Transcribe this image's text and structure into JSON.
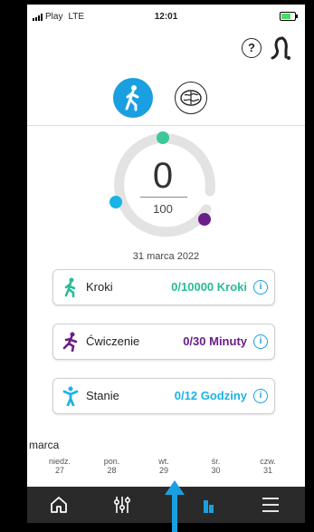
{
  "status": {
    "carrier": "Play",
    "network": "LTE",
    "time": "12:01"
  },
  "header": {
    "help_label": "?"
  },
  "ring": {
    "value": "0",
    "goal": "100",
    "colors": {
      "track": "#e3e3e3",
      "green": "#3ec79b",
      "blue": "#1ab3e6",
      "purple": "#6a1e8a"
    }
  },
  "date": "31 marca 2022",
  "cards": [
    {
      "label": "Kroki",
      "value": "0/10000 Kroki",
      "color": "#2bbb96",
      "icon": "walking-person-icon"
    },
    {
      "label": "Ćwiczenie",
      "value": "0/30 Minuty",
      "color": "#6a1e8a",
      "icon": "running-person-icon"
    },
    {
      "label": "Stanie",
      "value": "0/12 Godziny",
      "color": "#1ab3e6",
      "icon": "standing-person-icon"
    }
  ],
  "info_label": "i",
  "calendar": {
    "month": "marca",
    "days": [
      {
        "name": "niedz.",
        "num": "27"
      },
      {
        "name": "pon.",
        "num": "28"
      },
      {
        "name": "wt.",
        "num": "29"
      },
      {
        "name": "śr.",
        "num": "30"
      },
      {
        "name": "czw.",
        "num": "31"
      }
    ]
  },
  "nav": {
    "items": [
      "home-icon",
      "equalizer-icon",
      "stats-icon",
      "menu-icon"
    ]
  },
  "accent": "#1a9fe0"
}
